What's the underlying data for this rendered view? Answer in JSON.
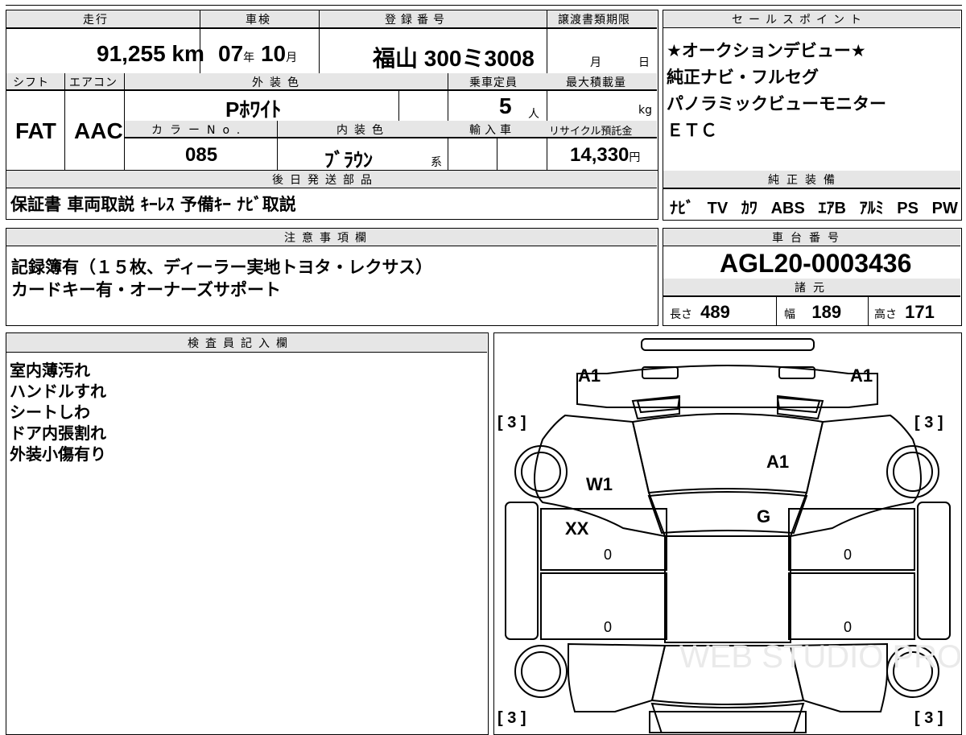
{
  "top_fragment": "",
  "basic": {
    "mileage_label": "走行",
    "mileage_value": "91,255",
    "mileage_unit": "km",
    "shaken_label": "車検",
    "shaken_year": "07",
    "shaken_year_unit": "年",
    "shaken_month": "10",
    "shaken_month_unit": "月",
    "reg_label": "登録番号",
    "reg_value": "福山 300ミ3008",
    "transfer_label": "譲渡書類期限",
    "transfer_month_unit": "月",
    "transfer_day_unit": "日"
  },
  "row2": {
    "shift_label": "シフト",
    "shift_value": "FAT",
    "ac_label": "エアコン",
    "ac_value": "AAC",
    "exterior_label": "外装色",
    "exterior_value": "Pﾎﾜｲﾄ",
    "capacity_label": "乗車定員",
    "capacity_value": "5",
    "capacity_unit": "人",
    "maxload_label": "最大積載量",
    "maxload_unit": "kg",
    "colorno_label": "カラーNo.",
    "colorno_value": "085",
    "interior_label": "内装色",
    "interior_value": "ﾌﾞﾗｳﾝ",
    "interior_suffix": "系",
    "import_label": "輸入車",
    "recycle_label": "リサイクル預託金",
    "recycle_value": "14,330",
    "recycle_unit": "円"
  },
  "later_parts": {
    "label": "後日発送部品",
    "value": "保証書 車両取説 ｷｰﾚｽ 予備ｷｰ ﾅﾋﾞ取説"
  },
  "sales_point": {
    "label": "セールスポイント",
    "lines": [
      "★オークションデビュー★",
      "純正ナビ・フルセグ",
      "パノラミックビューモニター",
      "ＥＴＣ"
    ]
  },
  "factory_equipment": {
    "label": "純正装備",
    "items": [
      "ﾅﾋﾞ",
      "TV",
      "ｶﾜ",
      "ABS",
      "ｴｱB",
      "ｱﾙﾐ",
      "PS",
      "PW"
    ]
  },
  "notes": {
    "label": "注意事項欄",
    "lines": [
      "記録簿有（１５枚、ディーラー実地トヨタ・レクサス）",
      "カードキー有・オーナーズサポート"
    ]
  },
  "chassis": {
    "label": "車台番号",
    "value": "AGL20-0003436"
  },
  "specs": {
    "label": "諸元",
    "length_label": "長さ",
    "length_value": "489",
    "width_label": "幅",
    "width_value": "189",
    "height_label": "高さ",
    "height_value": "171"
  },
  "inspector": {
    "label": "検査員記入欄",
    "lines": [
      "室内薄汚れ",
      "ハンドルすれ",
      "シートしわ",
      "ドア内張割れ",
      "外装小傷有り"
    ]
  },
  "diagram": {
    "tl": "A1",
    "tr": "A1",
    "hood": "A1",
    "windshield": "W1",
    "roof_front": "G",
    "left_front_door": "XX",
    "left_front_door_zero": "0",
    "left_rear_door_zero": "0",
    "right_front_door_zero": "0",
    "right_rear_door_zero": "0",
    "left_front_tire": "[ 3 ]",
    "right_front_tire": "[ 3 ]",
    "left_rear_tire": "[ 3 ]",
    "right_rear_tire": "[ 3 ]",
    "watermark": "WEB STUDIO PRO"
  }
}
